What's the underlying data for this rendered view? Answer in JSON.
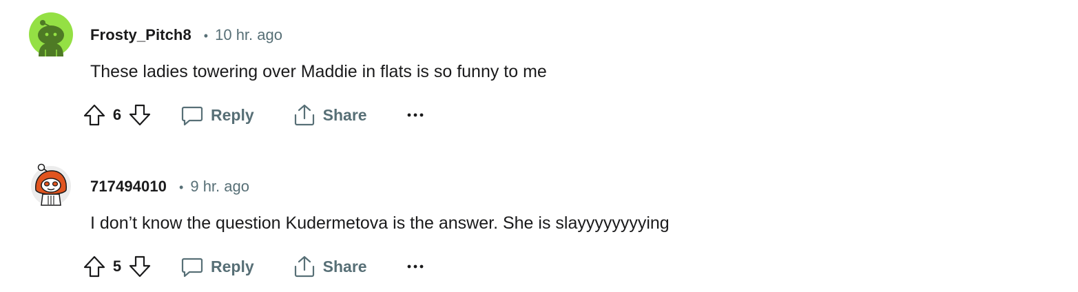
{
  "comments": [
    {
      "username": "Frosty_Pitch8",
      "separator": "•",
      "time": "10 hr. ago",
      "body": "These ladies towering over Maddie in flats is so funny to me",
      "score": "6",
      "reply_label": "Reply",
      "share_label": "Share",
      "avatar_color": "#94e044"
    },
    {
      "username": "717494010",
      "separator": "•",
      "time": "9 hr. ago",
      "body": "I don’t know the question Kudermetova is the answer. She is slayyyyyyyying",
      "score": "5",
      "reply_label": "Reply",
      "share_label": "Share",
      "avatar_color": "#e0541f"
    }
  ],
  "icons": {
    "upvote": "upvote-icon",
    "downvote": "downvote-icon",
    "reply": "comment-bubble-icon",
    "share": "share-icon",
    "more": "more-horizontal-icon"
  },
  "colors": {
    "text_primary": "#1a1a1b",
    "text_secondary": "#576f76"
  }
}
